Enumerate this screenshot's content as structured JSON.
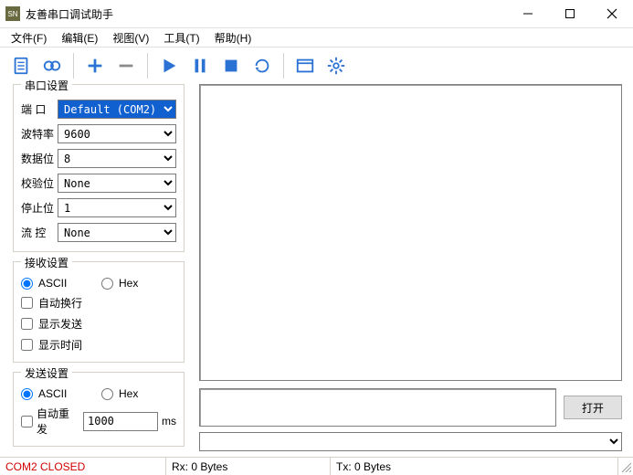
{
  "title": "友善串口调试助手",
  "menu": {
    "file": "文件(F)",
    "edit": "编辑(E)",
    "view": "视图(V)",
    "tools": "工具(T)",
    "help": "帮助(H)"
  },
  "port_group": {
    "title": "串口设置",
    "port_label": "端  口",
    "port_value": "Default (COM2)",
    "baud_label": "波特率",
    "baud_value": "9600",
    "databits_label": "数据位",
    "databits_value": "8",
    "parity_label": "校验位",
    "parity_value": "None",
    "stopbits_label": "停止位",
    "stopbits_value": "1",
    "flow_label": "流  控",
    "flow_value": "None"
  },
  "rx_group": {
    "title": "接收设置",
    "ascii": "ASCII",
    "hex": "Hex",
    "wrap": "自动换行",
    "show_send": "显示发送",
    "show_time": "显示时间"
  },
  "tx_group": {
    "title": "发送设置",
    "ascii": "ASCII",
    "hex": "Hex",
    "auto_resend": "自动重发",
    "resend_value": "1000",
    "ms": "ms"
  },
  "open_btn": "打开",
  "status": {
    "port": "COM2 CLOSED",
    "rx": "Rx: 0 Bytes",
    "tx": "Tx: 0 Bytes"
  }
}
